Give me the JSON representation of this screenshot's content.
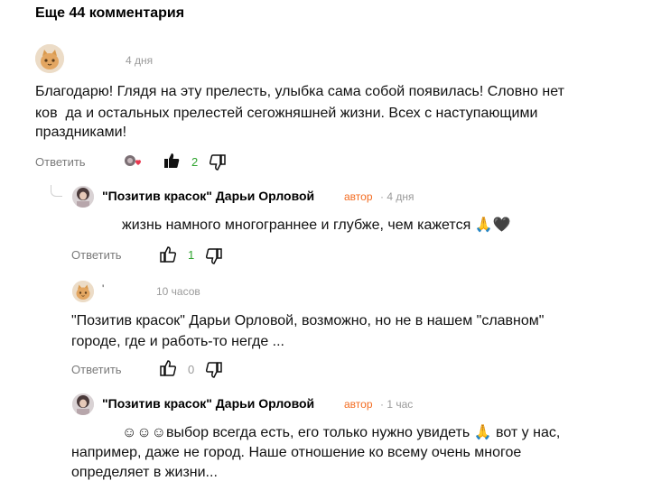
{
  "header": {
    "title": "Еще 44 комментария"
  },
  "comments": [
    {
      "author": "",
      "time": "4 дня",
      "text_line1": "Благодарю! Глядя на эту прелесть, улыбка сама собой появилась! Словно нет",
      "text_line2": "ков  да и остальных прелестей сегожняшней жизни. Всех с наступающими",
      "text_line3": "праздниками!",
      "reply_label": "Ответить",
      "likes": "2"
    },
    {
      "author": "\"Позитив красок\" Дарьи Орловой",
      "badge": "автор",
      "time": "· 4 дня",
      "text": "жизнь намного многограннее и глубже, чем кажется 🙏🖤",
      "reply_label": "Ответить",
      "likes": "1"
    },
    {
      "author": "'",
      "time": "10 часов",
      "text_line1": "\"Позитив красок\" Дарьи Орловой, возможно, но не в нашем \"славном\"",
      "text_line2": "городе, где и работь-то негде ...",
      "reply_label": "Ответить",
      "likes": "0"
    },
    {
      "author": "\"Позитив красок\" Дарьи Орловой",
      "badge": "автор",
      "time": "· 1 час",
      "text_line1": "☺☺☺выбор всегда есть, его только нужно увидеть 🙏 вот у нас,",
      "text_line2": "например, даже не город. Наше отношение ко всему очень многое",
      "text_line3": "определяет в жизни..."
    }
  ],
  "icons": {
    "avatar_default": "cat-avatar-icon",
    "like": "thumbs-up-icon",
    "dislike": "thumbs-down-icon",
    "reactions": "reaction-avatars-icon",
    "heart_color": "#e8384f"
  },
  "colors": {
    "badge": "#f36c21",
    "likes_positive": "#2fa42f",
    "muted": "#9a9a9a"
  }
}
